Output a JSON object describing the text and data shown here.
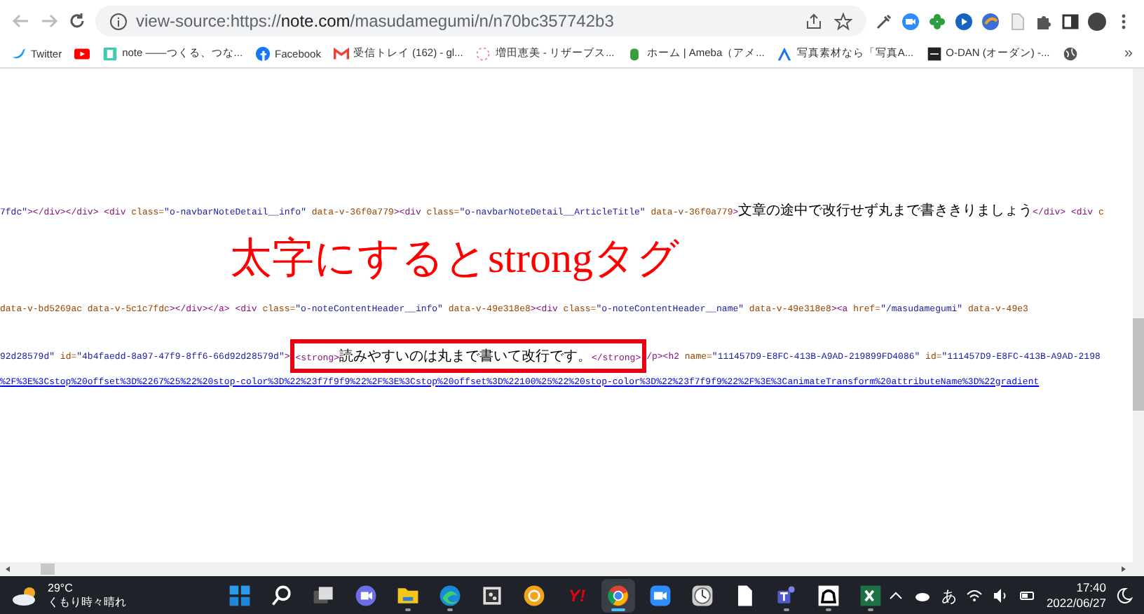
{
  "toolbar": {
    "url_prefix": "view-source:https://",
    "url_host": "note.com",
    "url_path": "/masudamegumi/n/n70bc357742b3"
  },
  "bookmarks": [
    {
      "label": "Twitter"
    },
    {
      "kind": "icon"
    },
    {
      "label": "note ——つくる、つな..."
    },
    {
      "label": "Facebook"
    },
    {
      "label": "受信トレイ (162) - gl..."
    },
    {
      "label": "増田恵美 - リザーブス..."
    },
    {
      "label": "ホーム | Ameba（アメ..."
    },
    {
      "label": "写真素材なら「写真A..."
    },
    {
      "label": "O-DAN (オーダン) -..."
    },
    {
      "kind": "icon"
    }
  ],
  "bookmarks_more": "»",
  "source_lines": [
    {
      "parts": [
        {
          "kind": "code",
          "segments": [
            {
              "kind": "value",
              "text": "7fdc\""
            },
            {
              "kind": "tag",
              "text": "></div></div> <div "
            },
            {
              "kind": "attr",
              "text": "class="
            },
            {
              "kind": "value",
              "text": "\"o-navbarNoteDetail__info\""
            },
            {
              "kind": "attr",
              "text": " data-v-36f0a779"
            },
            {
              "kind": "tag",
              "text": "><div "
            },
            {
              "kind": "attr",
              "text": "class="
            },
            {
              "kind": "value",
              "text": "\"o-navbarNoteDetail__ArticleTitle\""
            },
            {
              "kind": "attr",
              "text": " data-v-36f0a779"
            },
            {
              "kind": "tag",
              "text": ">"
            },
            {
              "kind": "text",
              "text": "文章の途中で改行せず丸まで書ききりましょう"
            },
            {
              "kind": "tag",
              "text": "</div> <div "
            },
            {
              "kind": "attr",
              "text": "c"
            }
          ]
        }
      ]
    },
    {
      "parts": [
        {
          "kind": "code",
          "segments": [
            {
              "kind": "attr",
              "text": "data-v-bd5269ac data-v-5c1c7fdc"
            },
            {
              "kind": "tag",
              "text": "></div></a> <div "
            },
            {
              "kind": "attr",
              "text": "class="
            },
            {
              "kind": "value",
              "text": "\"o-noteContentHeader__info\""
            },
            {
              "kind": "attr",
              "text": " data-v-49e318e8"
            },
            {
              "kind": "tag",
              "text": "><div "
            },
            {
              "kind": "attr",
              "text": "class="
            },
            {
              "kind": "value",
              "text": "\"o-noteContentHeader__name\""
            },
            {
              "kind": "attr",
              "text": " data-v-49e318e8"
            },
            {
              "kind": "tag",
              "text": "><a "
            },
            {
              "kind": "attr",
              "text": "href="
            },
            {
              "kind": "value",
              "text": "\"/masudamegumi\""
            },
            {
              "kind": "attr",
              "text": " data-v-49e3"
            }
          ]
        }
      ]
    },
    {
      "parts": [
        {
          "kind": "code",
          "segments": [
            {
              "kind": "value",
              "text": "92d28579d\""
            },
            {
              "kind": "attr",
              "text": " id="
            },
            {
              "kind": "value",
              "text": "\"4b4faedd-8a97-47f9-8ff6-66d92d28579d\""
            },
            {
              "kind": "tag",
              "text": ">"
            }
          ]
        },
        {
          "kind": "annotation",
          "segments": [
            {
              "kind": "tag",
              "text": "<strong>"
            },
            {
              "kind": "text",
              "text": "読みやすいのは丸まで書いて改行です。"
            },
            {
              "kind": "tag",
              "text": "</strong>"
            }
          ]
        },
        {
          "kind": "code",
          "segments": [
            {
              "kind": "tag",
              "text": "/p><h2 "
            },
            {
              "kind": "attr",
              "text": "name="
            },
            {
              "kind": "value",
              "text": "\"111457D9-E8FC-413B-A9AD-219899FD4086\""
            },
            {
              "kind": "attr",
              "text": " id="
            },
            {
              "kind": "value",
              "text": "\"111457D9-E8FC-413B-A9AD-2198"
            }
          ]
        }
      ]
    },
    {
      "parts": [
        {
          "kind": "link",
          "segments": [
            {
              "kind": "link",
              "text": "%2F%3E%3Cstop%20offset%3D%2267%25%22%20stop-color%3D%22%23f7f9f9%22%2F%3E%3Cstop%20offset%3D%22100%25%22%20stop-color%3D%22%23f7f9f9%22%2F%3E%3CanimateTransform%20attributeName%3D%22gradient"
            }
          ]
        }
      ]
    }
  ],
  "annotation_title": "太字にするとstrongタグ",
  "taskbar": {
    "temperature": "29°C",
    "weather": "くもり時々晴れ",
    "apps": [
      {
        "running": false,
        "active": false
      },
      {
        "running": false,
        "active": false
      },
      {
        "running": false,
        "active": false
      },
      {
        "running": false,
        "active": false
      },
      {
        "running": true,
        "active": false
      },
      {
        "running": true,
        "active": false
      },
      {
        "running": false,
        "active": false
      },
      {
        "running": false,
        "active": false
      },
      {
        "label": "Y!",
        "running": false,
        "active": false
      },
      {
        "running": true,
        "active": true
      },
      {
        "running": false,
        "active": false
      },
      {
        "running": false,
        "active": false
      },
      {
        "running": false,
        "active": false
      },
      {
        "running": true,
        "active": false
      },
      {
        "running": true,
        "active": false
      },
      {
        "running": true,
        "active": false
      }
    ],
    "ime": "あ",
    "time": "17:40",
    "date": "2022/06/27"
  }
}
